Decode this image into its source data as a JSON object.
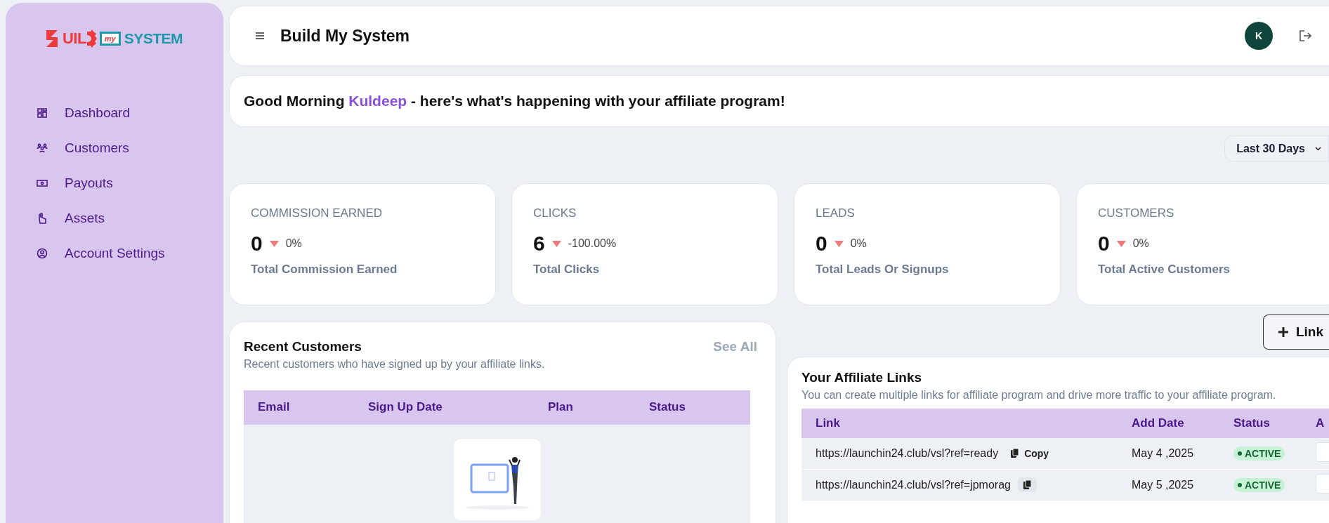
{
  "sidebar": {
    "logo": {
      "part_1": "UIL",
      "part_2": "my",
      "part_3": "SYSTEM"
    },
    "items": [
      {
        "label": "Dashboard",
        "kind": "dashboard",
        "selected": false
      },
      {
        "label": "Customers",
        "kind": "customers",
        "selected": false
      },
      {
        "label": "Payouts",
        "kind": "payouts",
        "selected": false
      },
      {
        "label": "Assets",
        "kind": "assets",
        "selected": false
      },
      {
        "label": "Account Settings",
        "kind": "account",
        "selected": false
      }
    ]
  },
  "header": {
    "title": "Build My System",
    "avatar": "K"
  },
  "greeting": {
    "text": "Good Morning",
    "name": "Kuldeep",
    "rest": "- here's what's happening with your affiliate program!"
  },
  "range_select": {
    "value": "Last 30 Days"
  },
  "stats": [
    {
      "title": "COMMISSION EARNED",
      "value": "0",
      "kind": "down",
      "change": "0%",
      "caption": "Total Commission Earned"
    },
    {
      "title": "CLICKS",
      "value": "6",
      "kind": "down",
      "change": "-100.00%",
      "caption": "Total Clicks"
    },
    {
      "title": "LEADS",
      "value": "0",
      "kind": "down",
      "change": "0%",
      "caption": "Total Leads Or Signups"
    },
    {
      "title": "CUSTOMERS",
      "value": "0",
      "kind": "down",
      "change": "0%",
      "caption": "Total Active Customers"
    }
  ],
  "recent_customers": {
    "title": "Recent Customers",
    "subtitle": "Recent customers who have signed up by your affiliate links.",
    "see_all": "See All",
    "columns": [
      "Email",
      "Sign Up Date",
      "Plan",
      "Status"
    ]
  },
  "add_link_button": {
    "label": "Link"
  },
  "affiliate_links": {
    "title": "Your Affiliate Links",
    "subtitle": "You can create multiple links for affiliate program and drive more traffic to your affiliate program.",
    "columns": [
      "Link",
      "Add Date",
      "Status",
      "A"
    ],
    "rows": [
      {
        "link": "https://launchin24.club/vsl?ref=ready",
        "copy_label": "Copy",
        "date": "May 4 ,2025",
        "status": "ACTIVE"
      },
      {
        "link": "https://launchin24.club/vsl?ref=jpmorag",
        "date": "May 5 ,2025",
        "status": "ACTIVE"
      }
    ]
  }
}
